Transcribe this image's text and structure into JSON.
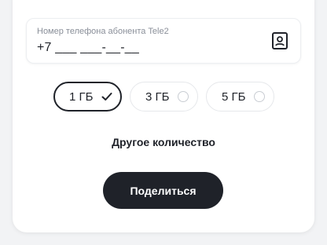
{
  "phone": {
    "label": "Номер телефона абонента Tele2",
    "value": "+7 ___ ___-__-__",
    "contacts_icon": "contact-book-icon"
  },
  "options": [
    {
      "label": "1 ГБ",
      "selected": true,
      "state_icon": "check-icon"
    },
    {
      "label": "3 ГБ",
      "selected": false,
      "state_icon": "radio-empty-icon"
    },
    {
      "label": "5 ГБ",
      "selected": false,
      "state_icon": "radio-empty-icon"
    }
  ],
  "other_amount": "Другое количество",
  "share_button": "Поделиться",
  "colors": {
    "primary": "#1f2229",
    "background": "#f2f3f5",
    "card": "#ffffff",
    "label": "#8a8f99"
  }
}
